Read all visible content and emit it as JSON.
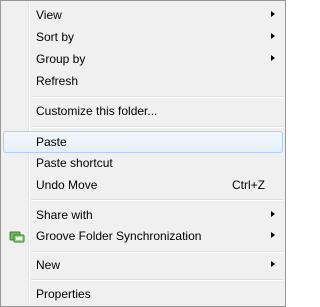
{
  "menu": {
    "items": [
      {
        "label": "View",
        "submenu": true
      },
      {
        "label": "Sort by",
        "submenu": true
      },
      {
        "label": "Group by",
        "submenu": true
      },
      {
        "label": "Refresh"
      },
      {
        "label": "Customize this folder..."
      },
      {
        "label": "Paste",
        "highlighted": true
      },
      {
        "label": "Paste shortcut"
      },
      {
        "label": "Undo Move",
        "shortcut": "Ctrl+Z"
      },
      {
        "label": "Share with",
        "submenu": true
      },
      {
        "label": "Groove Folder Synchronization",
        "submenu": true,
        "icon": "groove-sync-icon"
      },
      {
        "label": "New",
        "submenu": true
      },
      {
        "label": "Properties"
      }
    ]
  },
  "colors": {
    "menu_background": "#f0f0f0",
    "highlight_border": "#aecff7",
    "highlight_fill": "#e6eff9",
    "border": "#979797"
  }
}
